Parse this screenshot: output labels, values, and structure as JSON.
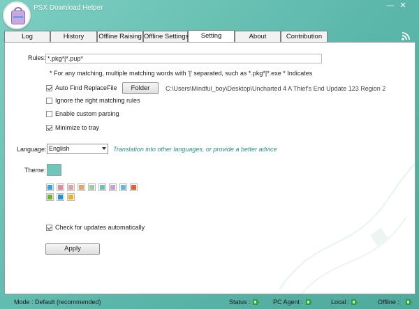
{
  "app": {
    "title": "PSX Download Helper"
  },
  "window_controls": {
    "minimize": "—",
    "close": "✕"
  },
  "tabs": [
    {
      "label": "Log",
      "active": false
    },
    {
      "label": "History",
      "active": false
    },
    {
      "label": "Offline Raising",
      "active": false
    },
    {
      "label": "Offline Settings",
      "active": false
    },
    {
      "label": "Setting",
      "active": true
    },
    {
      "label": "About",
      "active": false
    },
    {
      "label": "Contribution",
      "active": false
    }
  ],
  "settings": {
    "rules_label": "Rules:",
    "rules_value": "*.pkg*|*.pup*",
    "hint": "* For any matching, multiple matching words with '|' separated, such as *.pkg*|*.exe * Indicates",
    "auto_find": {
      "label": "Auto Find ReplaceFile",
      "checked": true
    },
    "folder_button": "Folder",
    "folder_path": "C:\\Users\\Mindful_boy\\Desktop\\Uncharted 4 A Thief's End Update 123 Region 2",
    "ignore_right": {
      "label": "Ignore the right matching rules",
      "checked": false
    },
    "custom_parsing": {
      "label": "Enable custom parsing",
      "checked": false
    },
    "minimize_tray": {
      "label": "Minimize to tray",
      "checked": true
    },
    "language_label": "Language:",
    "language_value": "English",
    "translation_link": "Translation into other languages, or provide a better advice",
    "theme_label": "Theme:",
    "theme_current": "#6dc6ba",
    "theme_swatches": [
      "#3aa0e0",
      "#e08aa0",
      "#e0a0a0",
      "#e8a070",
      "#a0c8a0",
      "#70c0b8",
      "#c0a0d8",
      "#60b8e0",
      "#e06030",
      "#70b030",
      "#2090e0",
      "#f0b020"
    ],
    "check_updates": {
      "label": "Check for updates automatically",
      "checked": true
    },
    "apply_button": "Apply"
  },
  "status": {
    "mode": "Mode :  Default (recommended)",
    "status_label": "Status :",
    "pc_agent_label": "PC Agent :",
    "local_label": "Local :",
    "offline_label": "Offline :"
  }
}
